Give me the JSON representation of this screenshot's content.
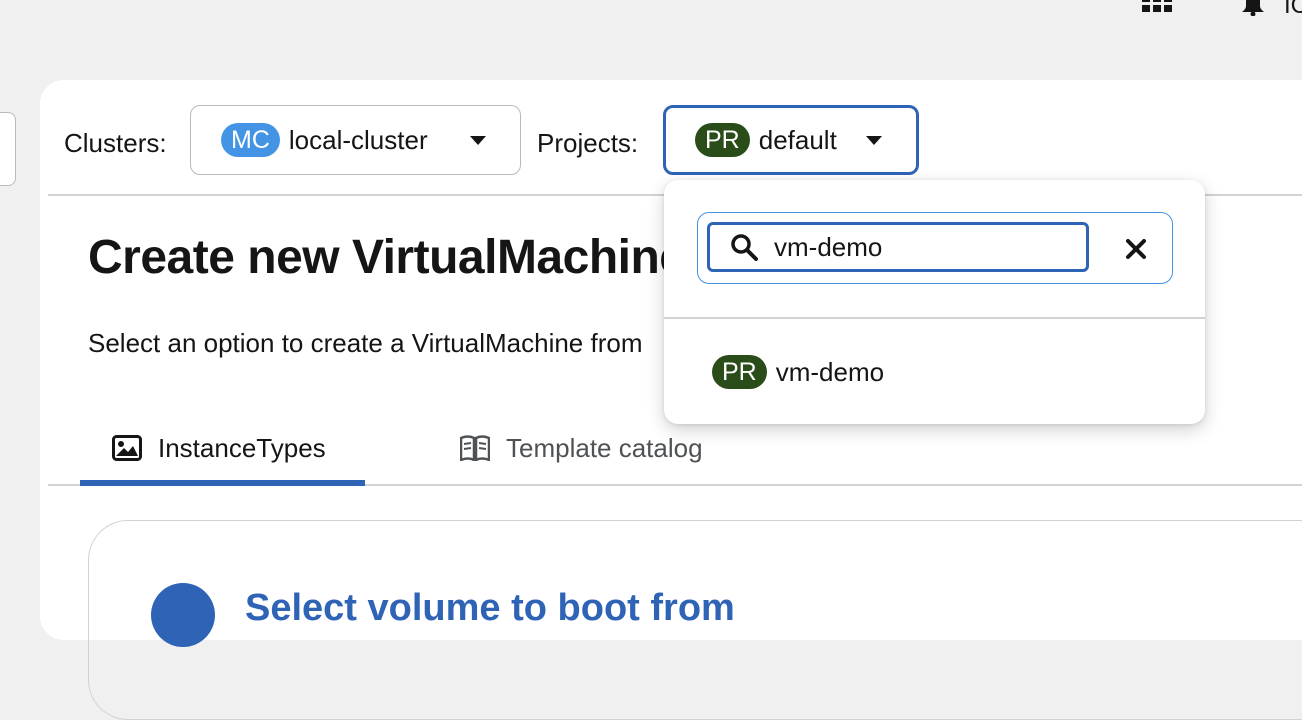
{
  "masthead": {
    "apps_icon": "grid-icon",
    "notifications_icon": "bell-icon",
    "user_initial": "IC"
  },
  "context_bar": {
    "clusters_label": "Clusters:",
    "cluster_badge": "MC",
    "cluster_value": "local-cluster",
    "projects_label": "Projects:",
    "project_badge": "PR",
    "project_value": "default"
  },
  "page": {
    "title": "Create new VirtualMachine",
    "description": "Select an option to create a VirtualMachine from"
  },
  "tabs": [
    {
      "label": "InstanceTypes",
      "icon": "image-icon",
      "active": true
    },
    {
      "label": "Template catalog",
      "icon": "book-icon",
      "active": false
    }
  ],
  "step": {
    "title": "Select volume to boot from"
  },
  "project_menu": {
    "search": {
      "value": "vm-demo",
      "icon": "search-icon",
      "clear_icon": "close-icon"
    },
    "items": [
      {
        "badge": "PR",
        "label": "vm-demo"
      }
    ]
  },
  "colors": {
    "accent_blue": "#2f63b6",
    "cluster_badge": "#4394e5",
    "project_badge": "#294c19",
    "background": "#f0f0f0"
  }
}
